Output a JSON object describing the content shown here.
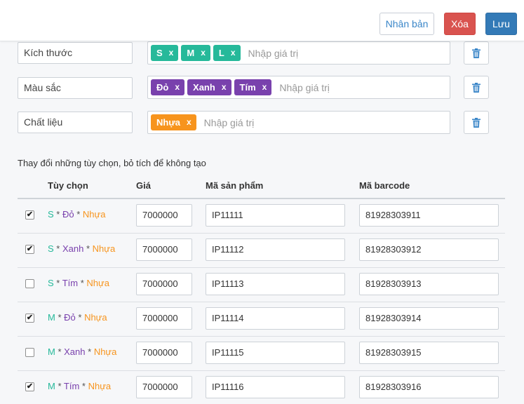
{
  "toolbar": {
    "duplicate_label": "Nhân bản",
    "delete_label": "Xóa",
    "save_label": "Lưu"
  },
  "options": [
    {
      "name": "Kích thước",
      "tags": [
        "S",
        "M",
        "L"
      ],
      "tag_color": "#26b99a",
      "placeholder": "Nhập giá trị"
    },
    {
      "name": "Màu sắc",
      "tags": [
        "Đỏ",
        "Xanh",
        "Tím"
      ],
      "tag_color": "#7941ad",
      "placeholder": "Nhập giá trị"
    },
    {
      "name": "Chất liệu",
      "tags": [
        "Nhựa"
      ],
      "tag_color": "#f7941d",
      "placeholder": "Nhập giá trị"
    }
  ],
  "tag_remove_glyph": "x",
  "variants": {
    "hint": "Thay đổi những tùy chọn, bỏ tích để không tạo",
    "headers": {
      "option": "Tùy chọn",
      "price": "Giá",
      "sku": "Mã sản phẩm",
      "barcode": "Mã barcode"
    },
    "separator": " * ",
    "rows": [
      {
        "checked": true,
        "size": "S",
        "color": "Đỏ",
        "material": "Nhựa",
        "price": "7000000",
        "sku": "IP11111",
        "barcode": "81928303911"
      },
      {
        "checked": true,
        "size": "S",
        "color": "Xanh",
        "material": "Nhựa",
        "price": "7000000",
        "sku": "IP11112",
        "barcode": "81928303912"
      },
      {
        "checked": false,
        "size": "S",
        "color": "Tím",
        "material": "Nhựa",
        "price": "7000000",
        "sku": "IP11113",
        "barcode": "81928303913"
      },
      {
        "checked": true,
        "size": "M",
        "color": "Đỏ",
        "material": "Nhựa",
        "price": "7000000",
        "sku": "IP11114",
        "barcode": "81928303914"
      },
      {
        "checked": false,
        "size": "M",
        "color": "Xanh",
        "material": "Nhựa",
        "price": "7000000",
        "sku": "IP11115",
        "barcode": "81928303915"
      },
      {
        "checked": true,
        "size": "M",
        "color": "Tím",
        "material": "Nhựa",
        "price": "7000000",
        "sku": "IP11116",
        "barcode": "81928303916"
      }
    ]
  },
  "icons": {
    "remove_option": "trash-icon",
    "check_mark": "check-icon"
  },
  "colors": {
    "size": "#26b99a",
    "color": "#7941ad",
    "material": "#f7941d",
    "danger": "#d9534f",
    "primary": "#337ab7",
    "link": "#3a86c8"
  }
}
